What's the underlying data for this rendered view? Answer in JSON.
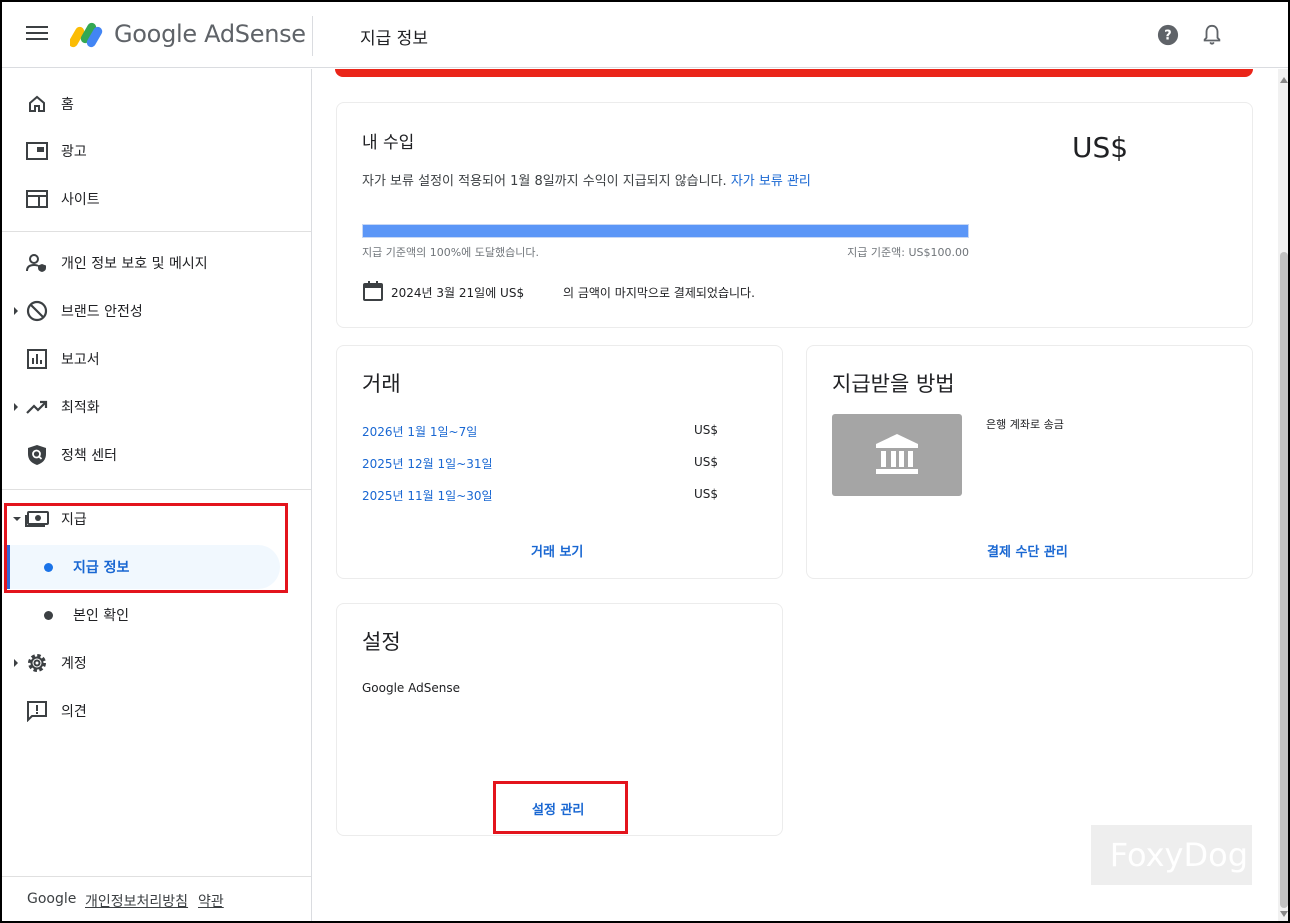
{
  "header": {
    "brand": "Google AdSense",
    "page_title": "지급 정보"
  },
  "sidebar": {
    "items": [
      {
        "label": "홈"
      },
      {
        "label": "광고"
      },
      {
        "label": "사이트"
      },
      {
        "label": "개인 정보 보호 및 메시지"
      },
      {
        "label": "브랜드 안전성"
      },
      {
        "label": "보고서"
      },
      {
        "label": "최적화"
      },
      {
        "label": "정책 센터"
      },
      {
        "label": "지급"
      },
      {
        "label": "계정"
      },
      {
        "label": "의견"
      }
    ],
    "sub_items": [
      {
        "label": "지급 정보"
      },
      {
        "label": "본인 확인"
      }
    ],
    "footer": {
      "google": "Google",
      "privacy": "개인정보처리방침",
      "terms": "약관"
    }
  },
  "earnings": {
    "title": "내 수입",
    "amount": "US$",
    "hold_notice": "자가 보류 설정이 적용되어 1월 8일까지 수익이 지급되지 않습니다.",
    "hold_link": "자가 보류 관리",
    "progress_percent": 100,
    "progress_left": "지급 기준액의 100%에 도달했습니다.",
    "progress_right": "지급 기준액: US$100.00",
    "last_payment_prefix": "2024년 3월 21일에 US$",
    "last_payment_suffix": "의 금액이 마지막으로 결제되었습니다."
  },
  "transactions": {
    "title": "거래",
    "rows": [
      {
        "period": "2026년 1월 1일~7일",
        "amount": "US$"
      },
      {
        "period": "2025년 12월 1일~31일",
        "amount": "US$"
      },
      {
        "period": "2025년 11월 1일~30일",
        "amount": "US$"
      }
    ],
    "view_link": "거래 보기"
  },
  "payment_method": {
    "title": "지급받을 방법",
    "method": "은행 계좌로 송금",
    "manage_link": "결제 수단 관리"
  },
  "settings": {
    "title": "설정",
    "name": "Google AdSense",
    "manage_link": "설정 관리"
  },
  "watermark": "FoxyDog",
  "colors": {
    "accent": "#1967d2",
    "progress": "#5b96f7",
    "alert": "#ea2519",
    "highlight_box": "#e3141d"
  }
}
